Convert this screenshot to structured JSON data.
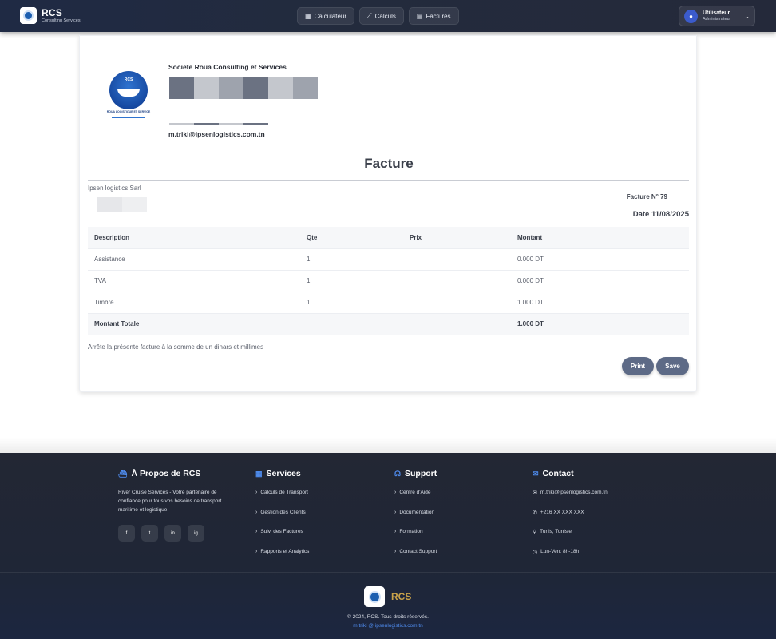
{
  "navbar": {
    "brand_title": "RCS",
    "brand_subtitle": "Consulting Services",
    "nav_items": [
      {
        "label": "Calculateur",
        "icon": "calculator-icon"
      },
      {
        "label": "Calculs",
        "icon": "chart-line-icon"
      },
      {
        "label": "Factures",
        "icon": "file-invoice-icon"
      }
    ],
    "user": {
      "name": "Utilisateur",
      "role": "Administrateur"
    }
  },
  "invoice": {
    "logo_caption": "ROUA LOGISTIQUE ET SERVICE",
    "logo_text": "RCS",
    "company_name": "Societe Roua Consulting et Services",
    "company_email": "m.triki@ipsenlogistics.com.tn",
    "title": "Facture",
    "client_name": "Ipsen logistics Sarl",
    "invoice_number": "Facture N° 79",
    "date": "Date 11/08/2025",
    "columns": [
      "Description",
      "Qte",
      "Prix",
      "Montant"
    ],
    "rows": [
      {
        "description": "Assistance",
        "qte": "1",
        "prix": "",
        "montant": "0.000 DT"
      },
      {
        "description": "TVA",
        "qte": "1",
        "prix": "",
        "montant": "0.000 DT"
      },
      {
        "description": "Timbre",
        "qte": "1",
        "prix": "",
        "montant": "1.000 DT"
      }
    ],
    "total_label": "Montant Totale",
    "total_amount": "1.000 DT",
    "amount_in_words": "Arrête la présente facture à la somme de un dinars et millimes",
    "print_label": "Print",
    "save_label": "Save",
    "redaction_colors": [
      "#6b7282",
      "#c4c7cd",
      "#9ea3ad",
      "#6b7282",
      "#c4c7cd",
      "#9ea3ad"
    ]
  },
  "footer": {
    "about": {
      "title": "À Propos de RCS",
      "text": "River Cruise Services - Votre partenaire de confiance pour tous vos besoins de transport maritime et logistique.",
      "social": [
        "f",
        "t",
        "in",
        "ig"
      ]
    },
    "services": {
      "title": "Services",
      "links": [
        "Calculs de Transport",
        "Gestion des Clients",
        "Suivi des Factures",
        "Rapports et Analytics"
      ]
    },
    "support": {
      "title": "Support",
      "links": [
        "Centre d'Aide",
        "Documentation",
        "Formation",
        "Contact Support"
      ]
    },
    "contact": {
      "title": "Contact",
      "items": [
        {
          "icon": "envelope-icon",
          "text": "m.triki@ipsenlogistics.com.tn"
        },
        {
          "icon": "phone-icon",
          "text": "+216 XX XXX XXX"
        },
        {
          "icon": "map-pin-icon",
          "text": "Tunis, Tunisie"
        },
        {
          "icon": "clock-icon",
          "text": "Lun-Ven: 8h-18h"
        }
      ]
    },
    "brand": "RCS",
    "copyright": "© 2024, RCS. Tous droits réservés.",
    "email_link": "m.triki @ ipsenlogistics.com.tn"
  }
}
